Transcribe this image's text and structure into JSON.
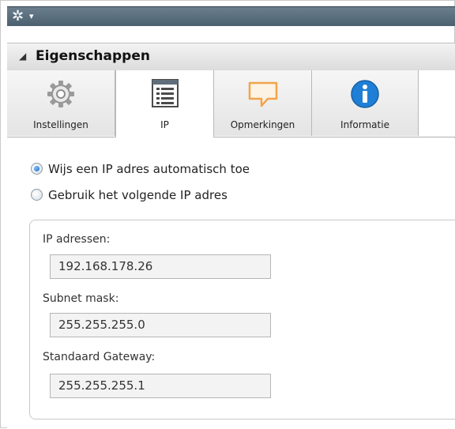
{
  "toolbar": {
    "menu_icon": "gear-icon",
    "menu_caret": "▾"
  },
  "panel": {
    "title": "Eigenschappen",
    "collapse_glyph": "◢"
  },
  "tabs": [
    {
      "label": "Instellingen",
      "icon": "settings-gear-icon",
      "active": false
    },
    {
      "label": "IP",
      "icon": "ip-list-icon",
      "active": true
    },
    {
      "label": "Opmerkingen",
      "icon": "comment-icon",
      "active": false
    },
    {
      "label": "Informatie",
      "icon": "info-icon",
      "active": false
    }
  ],
  "ip_mode": {
    "auto_label": "Wijs een IP adres automatisch toe",
    "manual_label": "Gebruik het volgende IP adres",
    "selected": "auto"
  },
  "fields": {
    "ip_label": "IP adressen:",
    "ip_value": "192.168.178.26",
    "subnet_label": "Subnet mask:",
    "subnet_value": "255.255.255.0",
    "gateway_label": "Standaard Gateway:",
    "gateway_value": "255.255.255.1"
  },
  "colors": {
    "titlebar": "#566b7a",
    "info_blue": "#1f7fd6",
    "comment_orange": "#f2a44a",
    "radio_selected": "#1a62c2"
  }
}
